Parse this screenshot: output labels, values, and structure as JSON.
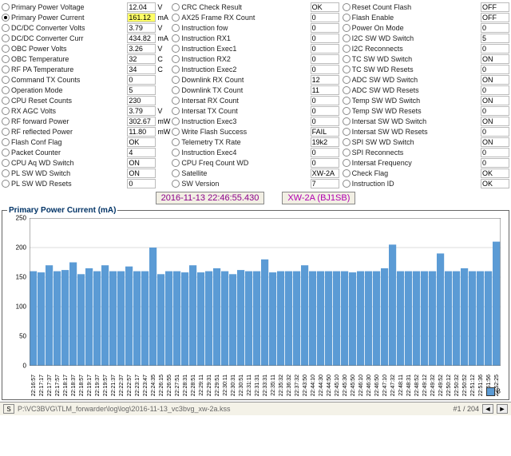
{
  "col1": [
    {
      "label": "Primary Power Voltage",
      "value": "12.04",
      "unit": "V",
      "sel": false
    },
    {
      "label": "Primary Power Current",
      "value": "161.12",
      "unit": "mA",
      "sel": true,
      "hi": true
    },
    {
      "label": "DC/DC Converter Volts",
      "value": "3.79",
      "unit": "V",
      "sel": false
    },
    {
      "label": "DC/DC Converter Curr",
      "value": "434.82",
      "unit": "mA",
      "sel": false
    },
    {
      "label": "OBC Power Volts",
      "value": "3.26",
      "unit": "V",
      "sel": false
    },
    {
      "label": "OBC Temperature",
      "value": "32",
      "unit": "C",
      "sel": false
    },
    {
      "label": "RF PA Temperature",
      "value": "34",
      "unit": "C",
      "sel": false
    },
    {
      "label": "Command TX Counts",
      "value": "0",
      "unit": "",
      "sel": false
    },
    {
      "label": "Operation Mode",
      "value": "5",
      "unit": "",
      "sel": false
    },
    {
      "label": "CPU Reset Counts",
      "value": "230",
      "unit": "",
      "sel": false
    },
    {
      "label": "RX AGC Volts",
      "value": "3.79",
      "unit": "V",
      "sel": false
    },
    {
      "label": "RF forward Power",
      "value": "302.67",
      "unit": "mW",
      "sel": false
    },
    {
      "label": "RF reflected Power",
      "value": "11.80",
      "unit": "mW",
      "sel": false
    },
    {
      "label": "Flash Conf Flag",
      "value": "OK",
      "unit": "",
      "sel": false
    },
    {
      "label": "Packet Counter",
      "value": "4",
      "unit": "",
      "sel": false
    },
    {
      "label": "CPU Aq WD Switch",
      "value": "ON",
      "unit": "",
      "sel": false
    },
    {
      "label": "PL SW WD Switch",
      "value": "ON",
      "unit": "",
      "sel": false
    },
    {
      "label": "PL SW WD Resets",
      "value": "0",
      "unit": "",
      "sel": false
    }
  ],
  "col2": [
    {
      "label": "CRC Check Result",
      "value": "OK"
    },
    {
      "label": "AX25 Frame RX Count",
      "value": "0"
    },
    {
      "label": "Instruction fow",
      "value": "0"
    },
    {
      "label": "Instruction RX1",
      "value": "0"
    },
    {
      "label": "Instruction Exec1",
      "value": "0"
    },
    {
      "label": "Instruction RX2",
      "value": "0"
    },
    {
      "label": "Instruction Exec2",
      "value": "0"
    },
    {
      "label": "Downlink RX Count",
      "value": "12"
    },
    {
      "label": "Downlink TX Count",
      "value": "11"
    },
    {
      "label": "Intersat RX Count",
      "value": "0"
    },
    {
      "label": "Intersat TX Count",
      "value": "0"
    },
    {
      "label": "Instruction Exec3",
      "value": "0"
    },
    {
      "label": "Write Flash Success",
      "value": "FAIL"
    },
    {
      "label": "Telemetry TX Rate",
      "value": "19k2"
    },
    {
      "label": "Instruction Exec4",
      "value": "0"
    },
    {
      "label": "CPU Freq Count WD",
      "value": "0"
    },
    {
      "label": "Satellite",
      "value": "XW-2A"
    },
    {
      "label": "SW Version",
      "value": "7"
    }
  ],
  "col3": [
    {
      "label": "Reset Count Flash",
      "value": "OFF"
    },
    {
      "label": "Flash Enable",
      "value": "OFF"
    },
    {
      "label": "Power On Mode",
      "value": "0"
    },
    {
      "label": "I2C SW WD Switch",
      "value": "5"
    },
    {
      "label": "I2C Reconnects",
      "value": "0"
    },
    {
      "label": "TC SW WD Switch",
      "value": "ON"
    },
    {
      "label": "TC SW WD Resets",
      "value": "0"
    },
    {
      "label": "ADC SW WD Switch",
      "value": "ON"
    },
    {
      "label": "ADC SW WD Resets",
      "value": "0"
    },
    {
      "label": "Temp SW WD Switch",
      "value": "ON"
    },
    {
      "label": "Temp SW WD Resets",
      "value": "0"
    },
    {
      "label": "Intersat SW WD Switch",
      "value": "ON"
    },
    {
      "label": "Intersat SW WD Resets",
      "value": "0"
    },
    {
      "label": "SPI SW WD Switch",
      "value": "ON"
    },
    {
      "label": "SPI Reconnects",
      "value": "0"
    },
    {
      "label": "Intersat Frequency",
      "value": "0"
    },
    {
      "label": "Check Flag",
      "value": "OK"
    },
    {
      "label": "Instruction ID",
      "value": "OK"
    }
  ],
  "banner": {
    "timestamp": "2016-11-13 22:46:55.430",
    "sat": "XW-2A (BJ1SB)"
  },
  "chart_title": "Primary Power Current (mA)",
  "legend_label": "B",
  "chart_data": {
    "type": "bar",
    "title": "Primary Power Current (mA)",
    "xlabel": "",
    "ylabel": "",
    "ylim": [
      0,
      250
    ],
    "yticks": [
      0,
      50,
      100,
      150,
      200,
      250
    ],
    "categories": [
      "22:16:57",
      "22:17:17",
      "22:17:37",
      "22:17:57",
      "22:18:17",
      "22:18:37",
      "22:18:57",
      "22:19:17",
      "22:19:37",
      "22:19:57",
      "22:21:37",
      "22:22:37",
      "22:22:57",
      "22:23:17",
      "22:23:47",
      "22:24:35",
      "22:26:15",
      "22:26:55",
      "22:27:51",
      "22:28:31",
      "22:28:51",
      "22:29:11",
      "22:29:31",
      "22:29:51",
      "22:30:11",
      "22:30:31",
      "22:30:51",
      "22:31:11",
      "22:31:31",
      "22:33:31",
      "22:35:11",
      "22:35:32",
      "22:36:32",
      "22:37:32",
      "22:43:50",
      "22:44:10",
      "22:44:30",
      "22:44:50",
      "22:45:10",
      "22:45:30",
      "22:45:50",
      "22:46:10",
      "22:46:30",
      "22:46:50",
      "22:47:10",
      "22:47:32",
      "22:48:11",
      "22:48:31",
      "22:48:52",
      "22:49:12",
      "22:49:32",
      "22:49:52",
      "22:50:12",
      "22:50:32",
      "22:50:52",
      "22:51:12",
      "22:51:36",
      "22:51:56",
      "22:52:25"
    ],
    "values": [
      160,
      158,
      170,
      160,
      162,
      175,
      155,
      165,
      160,
      170,
      160,
      160,
      168,
      160,
      160,
      200,
      155,
      160,
      160,
      158,
      170,
      158,
      160,
      165,
      160,
      155,
      162,
      160,
      160,
      180,
      158,
      160,
      160,
      160,
      170,
      160,
      160,
      160,
      160,
      160,
      158,
      160,
      160,
      160,
      165,
      205,
      160,
      160,
      160,
      160,
      160,
      190,
      160,
      160,
      165,
      160,
      160,
      160,
      210
    ]
  },
  "footer": {
    "s_label": "S",
    "path": "P:\\VC3BVG\\TLM_forwarder\\log\\log\\2016-11-13_vc3bvg_xw-2a.kss",
    "page": "#1 / 204",
    "left": "◄",
    "right": "►"
  }
}
